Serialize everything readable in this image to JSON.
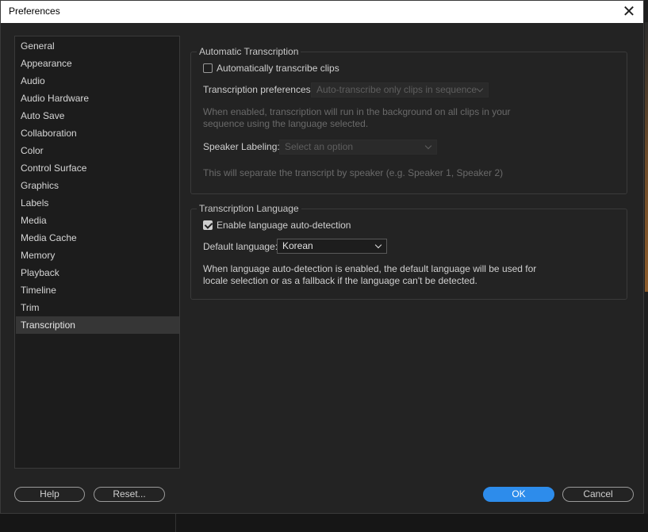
{
  "window": {
    "title": "Preferences"
  },
  "sidebar": {
    "items": [
      {
        "label": "General"
      },
      {
        "label": "Appearance"
      },
      {
        "label": "Audio"
      },
      {
        "label": "Audio Hardware"
      },
      {
        "label": "Auto Save"
      },
      {
        "label": "Collaboration"
      },
      {
        "label": "Color"
      },
      {
        "label": "Control Surface"
      },
      {
        "label": "Graphics"
      },
      {
        "label": "Labels"
      },
      {
        "label": "Media"
      },
      {
        "label": "Media Cache"
      },
      {
        "label": "Memory"
      },
      {
        "label": "Playback"
      },
      {
        "label": "Timeline"
      },
      {
        "label": "Trim"
      },
      {
        "label": "Transcription",
        "selected": true
      }
    ]
  },
  "auto_transcription": {
    "legend": "Automatic Transcription",
    "checkbox_label": "Automatically transcribe clips",
    "checked": false,
    "prefs_label": "Transcription preferences:",
    "prefs_value": "Auto-transcribe only clips in sequence",
    "desc_line1": "When enabled, transcription will run in the background on all clips in your",
    "desc_line2": "sequence using the language selected.",
    "speaker_label": "Speaker Labeling:",
    "speaker_placeholder": "Select an option",
    "speaker_desc": "This will separate the transcript by speaker (e.g. Speaker 1, Speaker 2)"
  },
  "transcription_language": {
    "legend": "Transcription Language",
    "checkbox_label": "Enable language auto-detection",
    "checked": true,
    "default_label": "Default language:",
    "default_value": "Korean",
    "desc_line1": "When language auto-detection is enabled, the default language will be used for",
    "desc_line2": "locale selection or as a fallback if the language can't be detected."
  },
  "buttons": {
    "help": "Help",
    "reset": "Reset...",
    "ok": "OK",
    "cancel": "Cancel"
  },
  "colors": {
    "accent": "#2d8ceb",
    "dialog_bg": "#232323",
    "selected_item_bg": "#363636"
  }
}
